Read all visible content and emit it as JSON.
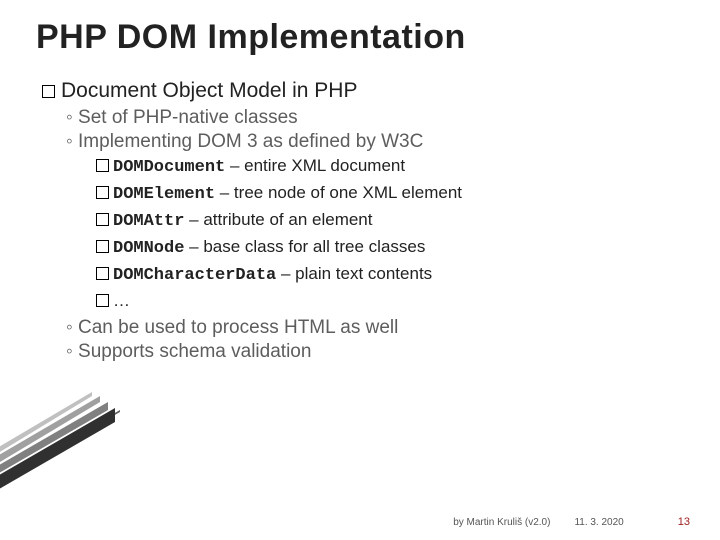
{
  "title": "PHP DOM Implementation",
  "l1": {
    "text": "Document Object Model in PHP"
  },
  "l2": {
    "a": "Set of PHP-native classes",
    "b": "Implementing DOM 3 as defined by W3C",
    "c": "Can be used to process HTML as well",
    "d": "Supports schema validation"
  },
  "l3": [
    {
      "code": "DOMDocument",
      "desc": " – entire XML document"
    },
    {
      "code": "DOMElement",
      "desc": " – tree node of one XML element"
    },
    {
      "code": "DOMAttr",
      "desc": " – attribute of an element"
    },
    {
      "code": "DOMNode",
      "desc": " – base class for all tree classes"
    },
    {
      "code": "DOMCharacterData",
      "desc": " – plain text contents"
    },
    {
      "code": "",
      "desc": "…"
    }
  ],
  "footer": {
    "author": "by Martin Kruliš (v2.0)",
    "date": "11. 3. 2020",
    "page": "13"
  }
}
